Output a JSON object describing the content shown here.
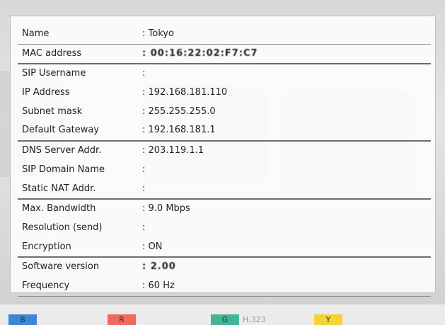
{
  "info": {
    "rows": [
      {
        "label": "Name",
        "value": "Tokyo"
      },
      {
        "label": "MAC address",
        "value": "00:16:22:02:F7:C7"
      },
      {
        "label": "SIP Username",
        "value": ""
      },
      {
        "label": "IP Address",
        "value": "192.168.181.110"
      },
      {
        "label": "Subnet mask",
        "value": "255.255.255.0"
      },
      {
        "label": "Default Gateway",
        "value": "192.168.181.1"
      },
      {
        "label": "DNS Server Addr.",
        "value": "203.119.1.1"
      },
      {
        "label": "SIP Domain Name",
        "value": ""
      },
      {
        "label": "Static NAT Addr.",
        "value": ""
      },
      {
        "label": "Max. Bandwidth",
        "value": "9.0 Mbps"
      },
      {
        "label": "Resolution (send)",
        "value": ""
      },
      {
        "label": "Encryption",
        "value": "ON"
      },
      {
        "label": "Software version",
        "value": "2.00"
      },
      {
        "label": "Frequency",
        "value": "60 Hz"
      }
    ]
  },
  "footer": {
    "keys": [
      {
        "label": "B",
        "color": "#3d86d8"
      },
      {
        "label": "R",
        "color": "#f06a5a"
      },
      {
        "label": "G",
        "color": "#43b596",
        "caption": "H.323"
      },
      {
        "label": "Y",
        "color": "#f4d23a"
      }
    ]
  }
}
